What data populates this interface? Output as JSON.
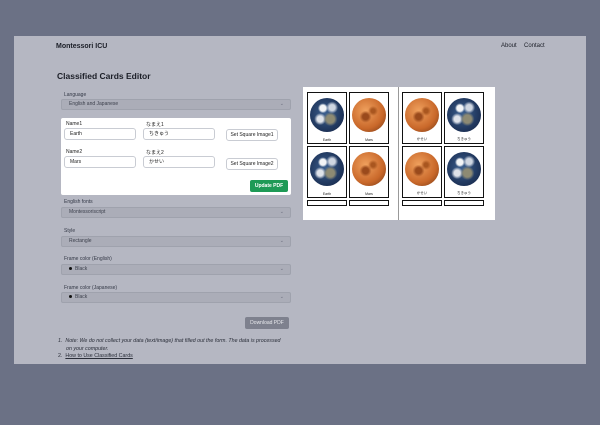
{
  "nav": {
    "brand": "Montessori ICU",
    "links": [
      "About",
      "Contact"
    ]
  },
  "page_title": "Classified Cards Editor",
  "language": {
    "label": "Language",
    "value": "English and Japanese"
  },
  "cards": {
    "name1_label": "Name1",
    "name1_value": "Earth",
    "jp1_label": "なまえ1",
    "jp1_value": "ちきゅう",
    "image1_button": "Set Square Image1",
    "name2_label": "Name2",
    "name2_value": "Mars",
    "jp2_label": "なまえ2",
    "jp2_value": "かせい",
    "image2_button": "Set Square Image2",
    "update_button": "Update PDF"
  },
  "english_fonts": {
    "label": "English fonts",
    "value": "Montessoriscript"
  },
  "style": {
    "label": "Style",
    "value": "Rectangle"
  },
  "frame_color_en": {
    "label": "Frame color (English)",
    "value": "Black"
  },
  "frame_color_jp": {
    "label": "Frame color (Japanese)",
    "value": "Black"
  },
  "download_button": "Download PDF",
  "notes": {
    "note1": "Note: We do not collect your data (text/image) that filled out the form. The data is processed",
    "note1b": "on your computer.",
    "note2": "How to Use Classified Cards"
  },
  "preview": {
    "left_captions": [
      "Earth",
      "Mars",
      "Earth",
      "Mars"
    ],
    "right_captions": [
      "かせい",
      "ちきゅう",
      "かせい",
      "ちきゅう"
    ]
  },
  "colors": {
    "accent": "#1e9a56",
    "background": "#6b7185",
    "panel": "#b5b7c2"
  },
  "icons": [
    "chevron-down-icon",
    "coffee-cup-icon"
  ]
}
